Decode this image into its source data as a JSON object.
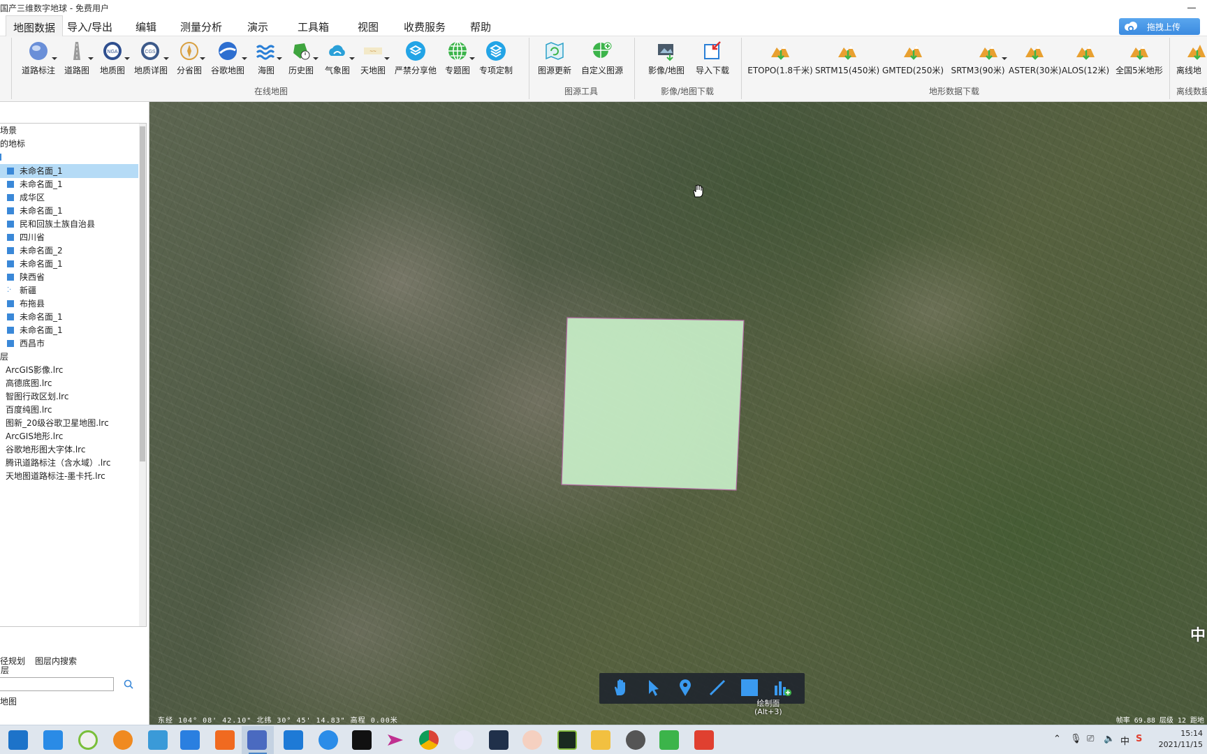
{
  "window": {
    "title": "国产三维数字地球 - 免费用户"
  },
  "menu": {
    "items": [
      "地图数据",
      "导入/导出",
      "编辑",
      "测量分析",
      "演示",
      "工具箱",
      "视图",
      "收费服务",
      "帮助"
    ],
    "upload_button": "拖拽上传"
  },
  "ribbon": {
    "online": {
      "label": "在线地图",
      "buttons": [
        "道路标注",
        "道路图",
        "地质图",
        "地质详图",
        "分省图",
        "谷歌地图",
        "海图",
        "历史图",
        "气象图",
        "天地图",
        "严禁分享他",
        "专题图",
        "专项定制"
      ]
    },
    "source_tools": {
      "label": "图源工具",
      "buttons": [
        "图源更新",
        "自定义图源"
      ]
    },
    "download": {
      "label": "影像/地图下载",
      "buttons": [
        "影像/地图",
        "导入下载"
      ]
    },
    "terrain": {
      "label": "地形数据下载",
      "buttons": [
        "ETOPO(1.8千米)",
        "SRTM15(450米)",
        "GMTED(250米)",
        "SRTM3(90米)",
        "ASTER(30米)",
        "ALOS(12米)",
        "全国5米地形"
      ]
    },
    "offline": {
      "label": "离线数据",
      "buttons": [
        "离线地"
      ]
    }
  },
  "left_panel": {
    "scene_header": "场景",
    "marks_header": "的地标",
    "places": [
      "未命名面_1",
      "未命名面_1",
      "成华区",
      "未命名面_1",
      "民和回族土族自治县",
      "四川省",
      "未命名面_2",
      "未命名面_1",
      "陕西省",
      "新疆",
      "布拖县",
      "未命名面_1",
      "未命名面_1",
      "西昌市"
    ],
    "layers_header": "层",
    "layers": [
      "ArcGIS影像.lrc",
      "高德底图.lrc",
      "智图行政区划.lrc",
      "百度纯图.lrc",
      "图新_20级谷歌卫星地图.lrc",
      "ArcGIS地形.lrc",
      "谷歌地形图大字体.lrc",
      "腾讯道路标注（含水域）.lrc",
      "天地图道路标注-墨卡托.lrc"
    ],
    "tab_route": "径规划",
    "tab_layer_search": "图层内搜索",
    "search_hint": "层",
    "map_item": "地图"
  },
  "map": {
    "draw_tooltip": "绘制面",
    "draw_shortcut": "(Alt+3)",
    "lang_char": "中",
    "coords": "东经 104° 08' 42.10\"  北纬 30° 45' 14.83\"   高程 0.00米",
    "status_right": "帧率 69.88  层级 12  距地"
  },
  "taskbar": {
    "ime": "中",
    "time": "15:14",
    "date": "2021/11/15"
  },
  "colors": {
    "polygon_fill": "#c8efc8",
    "polygon_edge": "#b06aa0",
    "tree_selection": "#b5dbf6",
    "accent": "#3a88d8"
  }
}
